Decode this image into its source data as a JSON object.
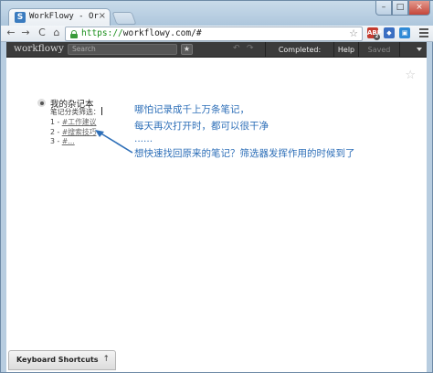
{
  "browser": {
    "tab_title": "WorkFlowy - Organize yo",
    "url_scheme": "https://",
    "url_rest": "workflowy.com/#",
    "close_glyph": "×",
    "ext_adblock": "ABP",
    "ext_adblock_count": "2"
  },
  "app": {
    "brand": "workflowy",
    "search_placeholder": "Search",
    "completed_label": "Completed: Visible",
    "help_label": "Help",
    "saved_label": "Saved"
  },
  "outline": {
    "title": "我的杂记本",
    "note_line_1": "笔记分类筛选：",
    "items": [
      {
        "prefix": "1 - ",
        "tag": "#工作建议"
      },
      {
        "prefix": "2 - ",
        "tag": "#搜索技巧"
      },
      {
        "prefix": "3 - ",
        "tag": "#..."
      }
    ]
  },
  "annotation": {
    "line1": "哪怕记录成千上万条笔记，",
    "line2": "每天再次打开时，都可以很干净",
    "line3": "......",
    "line4": "想快速找回原来的笔记？筛选器发挥作用的时候到了"
  },
  "footer": {
    "keyboard_shortcuts": "Keyboard Shortcuts",
    "toggle_glyph": "↑"
  },
  "colors": {
    "annotation": "#2e6fb8",
    "appbar": "#3b3b3b"
  }
}
